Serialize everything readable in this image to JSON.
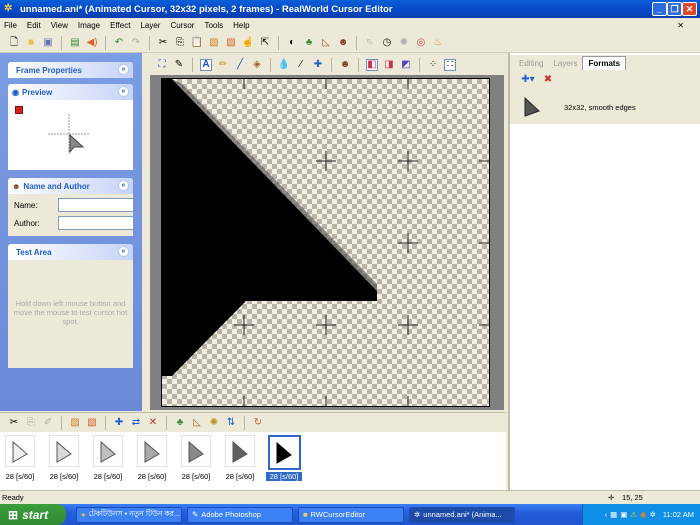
{
  "window": {
    "title": "unnamed.ani* (Animated Cursor, 32x32 pixels, 2 frames) - RealWorld Cursor Editor"
  },
  "menu": [
    "File",
    "Edit",
    "View",
    "Image",
    "Effect",
    "Layer",
    "Cursor",
    "Tools",
    "Help"
  ],
  "left": {
    "frame_properties": "Frame Properties",
    "preview": "Preview",
    "name_author": "Name and Author",
    "name_label": "Name:",
    "author_label": "Author:",
    "name_value": "",
    "author_value": "",
    "test_area": "Test Area",
    "test_hint": "Hold down left mouse button and move the mouse to test cursor hot spot."
  },
  "right": {
    "tabs": [
      {
        "label": "Editing"
      },
      {
        "label": "Layers"
      },
      {
        "label": "Formats",
        "active": true
      }
    ],
    "format": "32x32, smooth edges"
  },
  "frames": [
    {
      "label": "28 [s/60]",
      "shade": "#f0f0f0"
    },
    {
      "label": "28 [s/60]",
      "shade": "#d8d8d8"
    },
    {
      "label": "28 [s/60]",
      "shade": "#c0c0c0"
    },
    {
      "label": "28 [s/60]",
      "shade": "#a8a8a8"
    },
    {
      "label": "28 [s/60]",
      "shade": "#8a8a8a"
    },
    {
      "label": "28 [s/60]",
      "shade": "#606060"
    },
    {
      "label": "28 [s/60]",
      "shade": "#000000",
      "selected": true
    }
  ],
  "status": {
    "text": "Ready",
    "coords": "15, 25"
  },
  "taskbar": {
    "start": "start",
    "tasks": [
      "টেকটিউনস • নতুন টিউন কর...",
      "Adobe Photoshop",
      "RWCursorEditor",
      "unnamed.ani* (Anima..."
    ],
    "clock": "11:02 AM"
  },
  "colors": {
    "accent": "#316ac5",
    "panel_header": "#215dc6"
  }
}
